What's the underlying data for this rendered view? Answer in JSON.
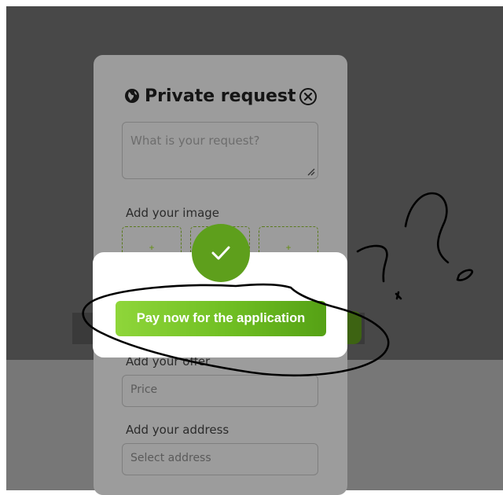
{
  "form": {
    "title": "Private request",
    "request_placeholder": "What is your request?",
    "image_label": "Add your image",
    "image_slots": [
      "+",
      "+",
      "+"
    ],
    "offer_label": "Add your offer",
    "price_placeholder": "Price",
    "address_label": "Add your address",
    "address_placeholder": "Select address"
  },
  "modal": {
    "pay_button_label": "Pay now for the application"
  },
  "icons": {
    "title": "globe-icon",
    "close": "close-circle-icon",
    "success": "checkmark-icon"
  },
  "colors": {
    "accent_green": "#5e9f1c",
    "button_gradient_start": "#8fd63a",
    "button_gradient_end": "#55a115"
  }
}
